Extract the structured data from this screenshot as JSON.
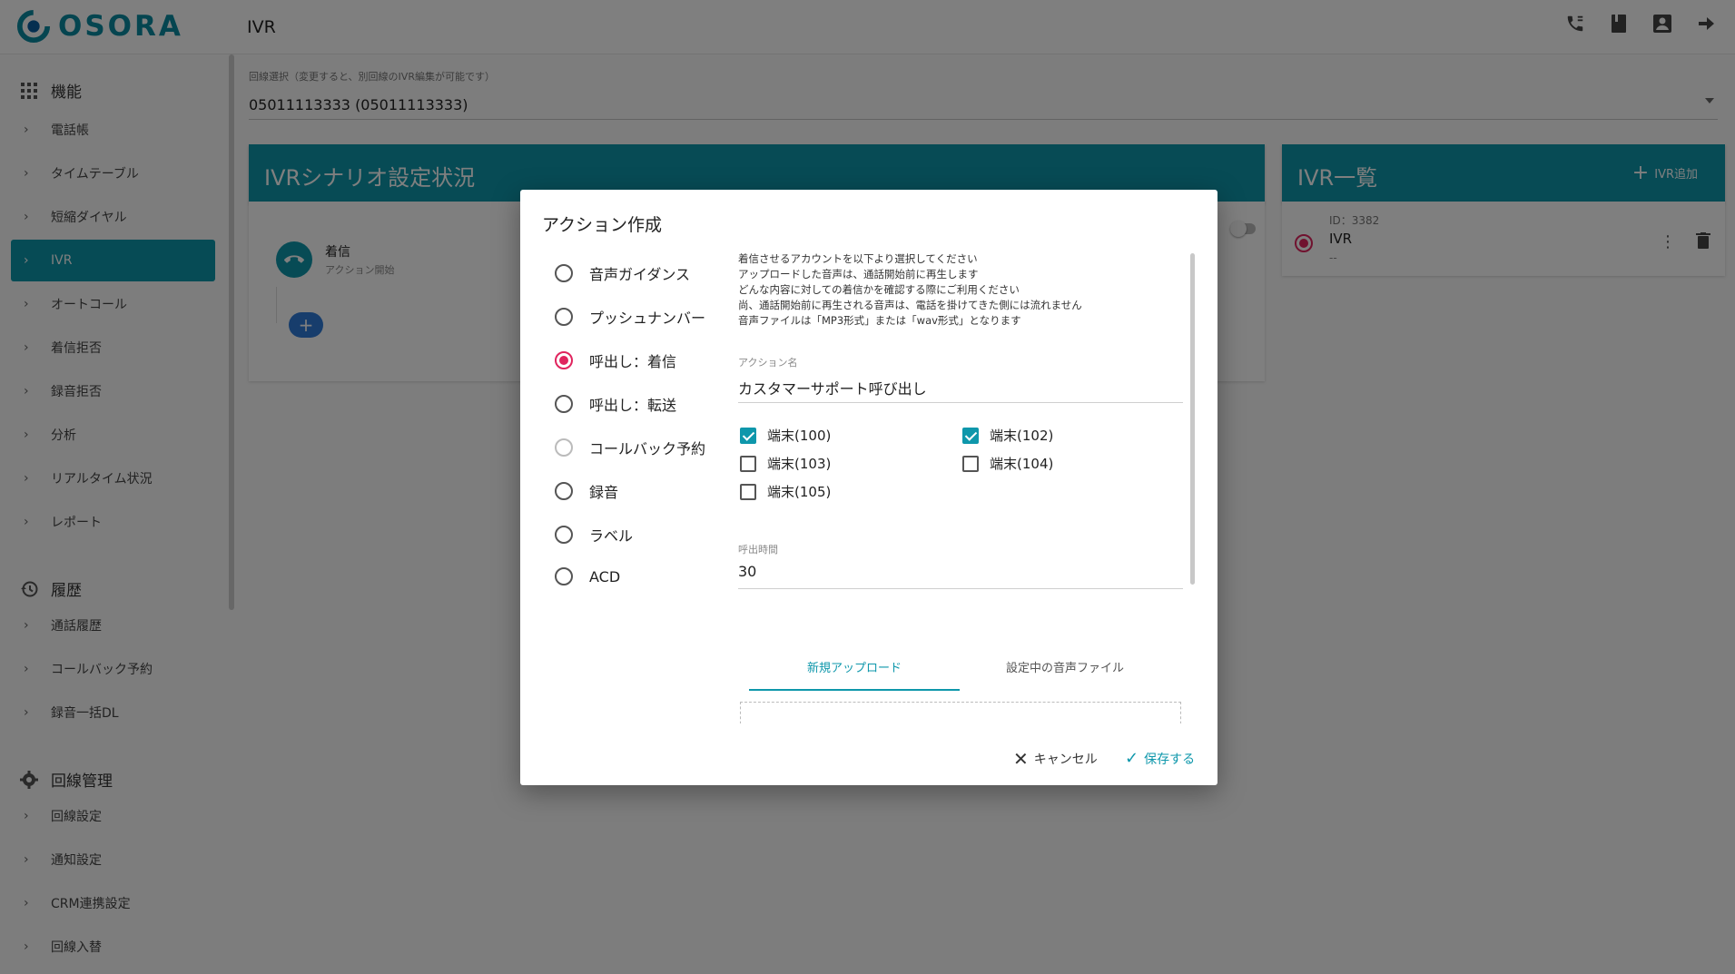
{
  "app": {
    "logo_text": "OSORA",
    "page_title": "IVR"
  },
  "topbar_icons": [
    "phone-settings-icon",
    "book-icon",
    "account-box-icon",
    "logout-icon"
  ],
  "sidebar": {
    "sections": [
      {
        "title": "機能",
        "icon": "grid-icon"
      },
      {
        "title": "履歴",
        "icon": "history-icon"
      },
      {
        "title": "回線管理",
        "icon": "gear-icon"
      }
    ],
    "functions": [
      "電話帳",
      "タイムテーブル",
      "短縮ダイヤル",
      "IVR",
      "オートコール",
      "着信拒否",
      "録音拒否",
      "分析",
      "リアルタイム状況",
      "レポート"
    ],
    "history": [
      "通話履歴",
      "コールバック予約",
      "録音一括DL"
    ],
    "line_management": [
      "回線設定",
      "通知設定",
      "CRM連携設定",
      "回線入替"
    ],
    "active_item": "IVR"
  },
  "line_select": {
    "label": "回線選択（変更すると、別回線のIVR編集が可能です）",
    "value": "05011113333 (05011113333)"
  },
  "scenario_panel": {
    "title": "IVRシナリオ設定状況",
    "start_node_title": "着信",
    "start_node_sub": "アクション開始",
    "add_label": "+"
  },
  "ivr_panel": {
    "title": "IVR一覧",
    "add_label": "IVR追加",
    "items": [
      {
        "id": "ID：3382",
        "name": "IVR",
        "desc": "--"
      }
    ]
  },
  "dialog": {
    "title": "アクション作成",
    "action_types": [
      {
        "label": "音声ガイダンス",
        "state": "unchecked"
      },
      {
        "label": "プッシュナンバー",
        "state": "unchecked"
      },
      {
        "label": "呼出し：着信",
        "state": "checked"
      },
      {
        "label": "呼出し：転送",
        "state": "unchecked"
      },
      {
        "label": "コールバック予約",
        "state": "disabled"
      },
      {
        "label": "録音",
        "state": "unchecked"
      },
      {
        "label": "ラベル",
        "state": "unchecked"
      },
      {
        "label": "ACD",
        "state": "unchecked"
      }
    ],
    "info_text": "着信させるアカウントを以下より選択してください\nアップロードした音声は、通話開始前に再生します\nどんな内容に対しての着信かを確認する際にご利用ください\n尚、通話開始前に再生される音声は、電話を掛けてきた側には流れません\n音声ファイルは「MP3形式」または「wav形式」となります",
    "action_name_label": "アクション名",
    "action_name_value": "カスタマーサポート呼び出し",
    "terminals": [
      {
        "label": "端末(100)",
        "checked": true
      },
      {
        "label": "端末(102)",
        "checked": true
      },
      {
        "label": "端末(103)",
        "checked": false
      },
      {
        "label": "端末(104)",
        "checked": false
      },
      {
        "label": "端末(105)",
        "checked": false
      }
    ],
    "call_time_label": "呼出時間",
    "call_time_value": "30",
    "tabs": [
      {
        "label": "新規アップロード",
        "active": true
      },
      {
        "label": "設定中の音声ファイル",
        "active": false
      }
    ],
    "cancel_label": "キャンセル",
    "save_label": "保存する"
  },
  "colors": {
    "accent": "#0e97ab",
    "radio_checked": "#e0245e",
    "add_button": "#2f7bd8"
  }
}
